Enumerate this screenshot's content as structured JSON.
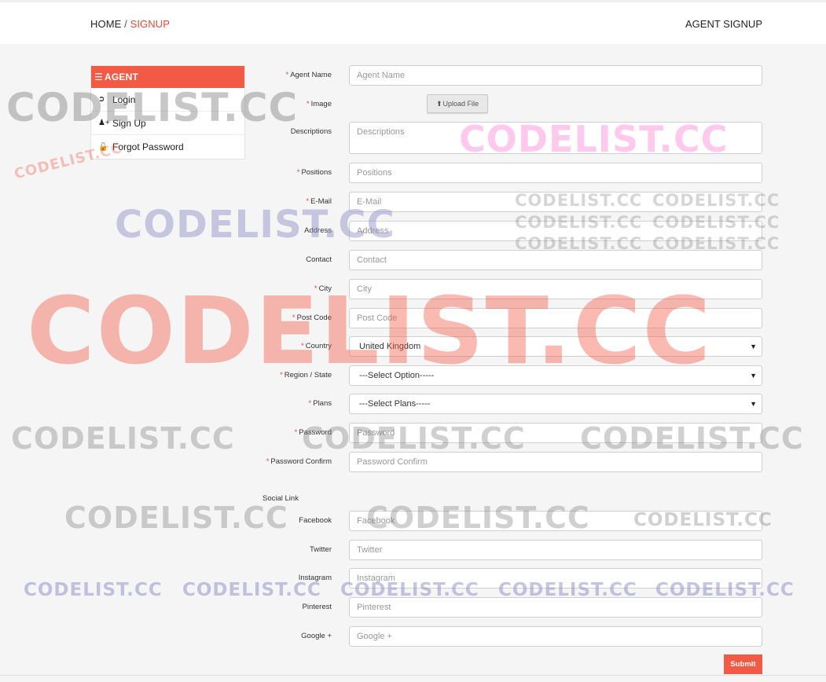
{
  "breadcrumb": {
    "home": "HOME",
    "separator": "/",
    "current": "SIGNUP"
  },
  "page_title": "AGENT SIGNUP",
  "sidebar": {
    "header": "AGENT",
    "items": [
      {
        "label": "Login",
        "icon": "sign-in-icon"
      },
      {
        "label": "Sign Up",
        "icon": "user-plus-icon"
      },
      {
        "label": "Forgot Password",
        "icon": "lock-icon"
      }
    ]
  },
  "form": {
    "agent_name": {
      "label": "Agent Name",
      "placeholder": "Agent Name"
    },
    "image": {
      "label": "Image",
      "upload_label": "Upload File"
    },
    "descriptions": {
      "label": "Descriptions",
      "placeholder": "Descriptions"
    },
    "positions": {
      "label": "Positions",
      "placeholder": "Positions"
    },
    "email": {
      "label": "E-Mail",
      "placeholder": "E-Mail"
    },
    "address": {
      "label": "Address",
      "placeholder": "Address"
    },
    "contact": {
      "label": "Contact",
      "placeholder": "Contact"
    },
    "city": {
      "label": "City",
      "placeholder": "City"
    },
    "post_code": {
      "label": "Post Code",
      "placeholder": "Post Code"
    },
    "country": {
      "label": "Country",
      "value": "United Kingdom"
    },
    "region": {
      "label": "Region / State",
      "value": "---Select Option-----"
    },
    "plans": {
      "label": "Plans",
      "value": "---Select Plans-----"
    },
    "password": {
      "label": "Password",
      "placeholder": "Password"
    },
    "password_confirm": {
      "label": "Password Confirm",
      "placeholder": "Password Confirm"
    },
    "social_section": "Social Link",
    "facebook": {
      "label": "Facebook",
      "placeholder": "Facebook"
    },
    "twitter": {
      "label": "Twitter",
      "placeholder": "Twitter"
    },
    "instagram": {
      "label": "Instagram",
      "placeholder": "Instagram"
    },
    "pinterest": {
      "label": "Pinterest",
      "placeholder": "Pinterest"
    },
    "google": {
      "label": "Google +",
      "placeholder": "Google +"
    },
    "submit_label": "Submit",
    "required_mark": "*"
  },
  "watermark": "CODELIST.CC",
  "colors": {
    "accent": "#f25a45",
    "required": "#e8483a"
  }
}
